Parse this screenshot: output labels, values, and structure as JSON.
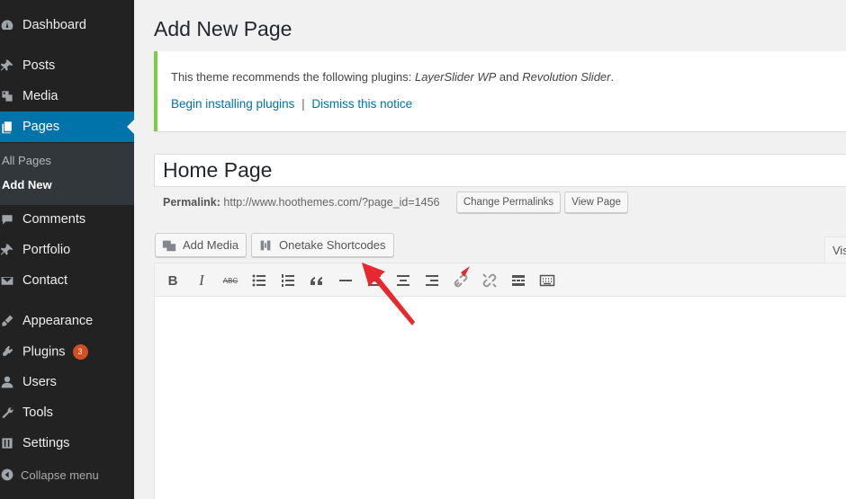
{
  "sidebar": {
    "items": [
      {
        "label": "Dashboard",
        "icon": "dashboard-icon"
      },
      {
        "label": "Posts",
        "icon": "pin-icon"
      },
      {
        "label": "Media",
        "icon": "media-icon"
      },
      {
        "label": "Pages",
        "icon": "pages-icon",
        "current": true
      },
      {
        "label": "Comments",
        "icon": "comment-icon"
      },
      {
        "label": "Portfolio",
        "icon": "pin-icon"
      },
      {
        "label": "Contact",
        "icon": "mail-icon"
      },
      {
        "label": "Appearance",
        "icon": "brush-icon"
      },
      {
        "label": "Plugins",
        "icon": "plugin-icon",
        "badge": "3"
      },
      {
        "label": "Users",
        "icon": "user-icon"
      },
      {
        "label": "Tools",
        "icon": "wrench-icon"
      },
      {
        "label": "Settings",
        "icon": "settings-icon"
      }
    ],
    "submenu": [
      "All Pages",
      "Add New"
    ],
    "collapse_label": "Collapse menu"
  },
  "main": {
    "page_title": "Add New Page",
    "notice": {
      "text_before": "This theme recommends the following plugins: ",
      "plugin_1": "LayerSlider WP",
      "text_and": " and ",
      "plugin_2": "Revolution Slider",
      "text_after": ".",
      "link_install": "Begin installing plugins",
      "separator": "|",
      "link_dismiss": "Dismiss this notice"
    },
    "title_value": "Home Page",
    "permalink": {
      "label": "Permalink:",
      "url": "http://www.hoothemes.com/?page_id=1456",
      "change_button": "Change Permalinks",
      "view_button": "View Page"
    },
    "buttons": {
      "add_media": "Add Media",
      "onetake_shortcodes": "Onetake Shortcodes"
    },
    "visual_tab": "Vis",
    "toolbar": {
      "bold": "B",
      "italic": "I",
      "strike": "ABC"
    }
  },
  "colors": {
    "sidebar_bg": "#222222",
    "accent": "#0073aa",
    "notice_border": "#7ad03a",
    "badge": "#d54e21",
    "arrow": "#e8282f"
  }
}
